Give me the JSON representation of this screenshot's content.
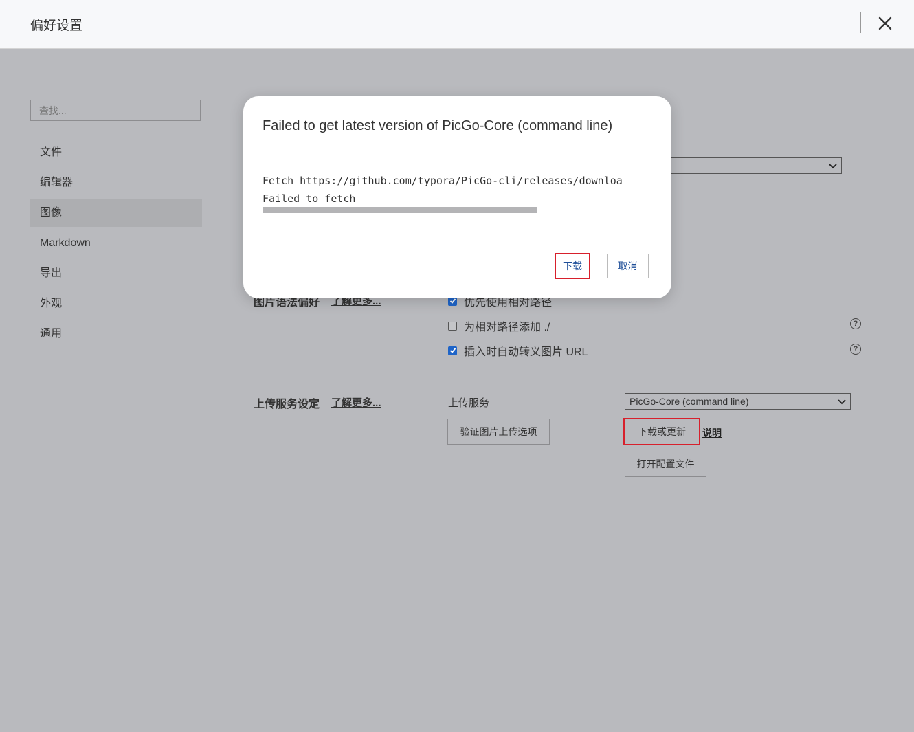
{
  "window": {
    "title": "偏好设置"
  },
  "sidebar": {
    "search_placeholder": "查找...",
    "items": [
      {
        "label": "文件",
        "active": false
      },
      {
        "label": "编辑器",
        "active": false
      },
      {
        "label": "图像",
        "active": true
      },
      {
        "label": "Markdown",
        "active": false
      },
      {
        "label": "导出",
        "active": false
      },
      {
        "label": "外观",
        "active": false
      },
      {
        "label": "通用",
        "active": false
      }
    ]
  },
  "image_syntax": {
    "section_title": "图片语法偏好",
    "learn_more": "了解更多...",
    "options": [
      {
        "label": "优先使用相对路径",
        "checked": true
      },
      {
        "label": "为相对路径添加 ./",
        "checked": false
      },
      {
        "label": "插入时自动转义图片 URL",
        "checked": true
      }
    ]
  },
  "upload": {
    "section_title": "上传服务设定",
    "learn_more": "了解更多...",
    "service_label": "上传服务",
    "service_value": "PicGo-Core (command line)",
    "verify_button": "验证图片上传选项",
    "download_update_button": "下载或更新",
    "help_link": "说明",
    "open_config_button": "打开配置文件"
  },
  "modal": {
    "title": "Failed to get latest version of PicGo-Core (command line)",
    "log_lines": [
      "Fetch https://github.com/typora/PicGo-cli/releases/downloa",
      "Failed to fetch"
    ],
    "progress": 1.0,
    "download_button": "下载",
    "cancel_button": "取消"
  },
  "colors": {
    "accent": "#1e64c8",
    "highlight_outline": "#d7202c",
    "overlay_bg": "#b9babe"
  }
}
